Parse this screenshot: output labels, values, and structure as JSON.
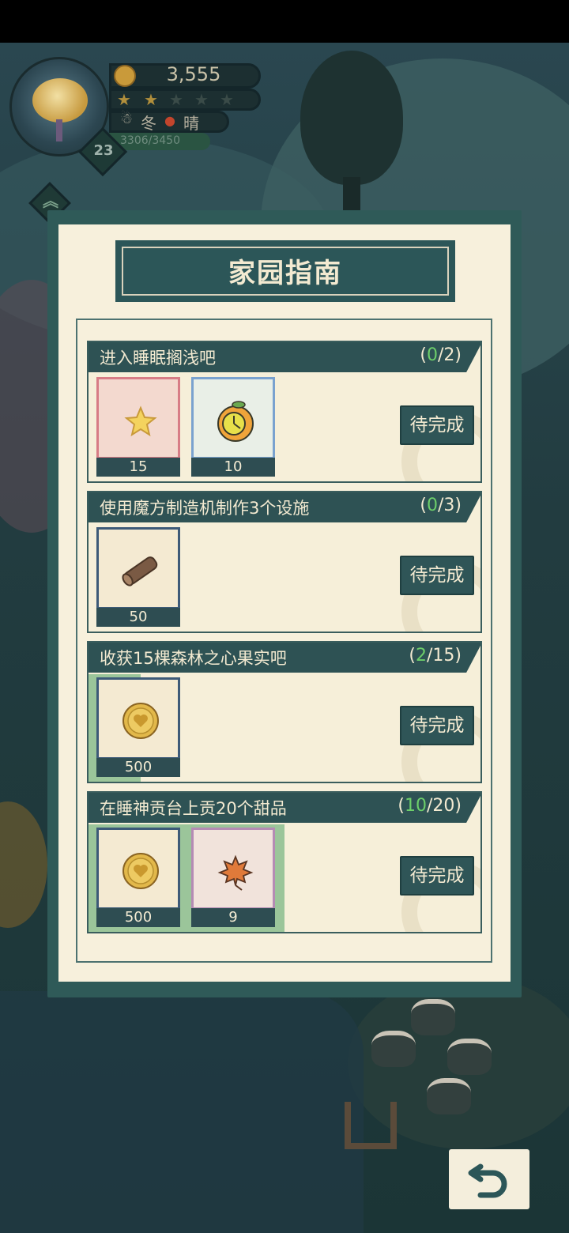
{
  "hud": {
    "coins": "3,555",
    "stars_filled": 2,
    "stars_total": 5,
    "season": "冬",
    "weather": "晴",
    "xp": "3306/3450",
    "level": "23"
  },
  "dialog": {
    "title": "家园指南",
    "tasks": [
      {
        "title": "进入睡眠搁浅吧",
        "progress_current": "0",
        "progress_total": "2",
        "progress_fraction": 0.0,
        "action_label": "待完成",
        "rewards": [
          {
            "icon": "star-icon",
            "count": "15",
            "frame_color": "#d77c86"
          },
          {
            "icon": "fruit-clock-icon",
            "count": "10",
            "frame_color": "#7aa2cf"
          }
        ]
      },
      {
        "title": "使用魔方制造机制作3个设施",
        "progress_current": "0",
        "progress_total": "3",
        "progress_fraction": 0.0,
        "action_label": "待完成",
        "rewards": [
          {
            "icon": "wood-log-icon",
            "count": "50",
            "frame_color": "#3d5a78"
          }
        ]
      },
      {
        "title": "收获15棵森林之心果实吧",
        "progress_current": "2",
        "progress_total": "15",
        "progress_fraction": 0.133,
        "action_label": "待完成",
        "rewards": [
          {
            "icon": "heart-coin-icon",
            "count": "500",
            "frame_color": "#3d5a78"
          }
        ]
      },
      {
        "title": "在睡神贡台上贡20个甜品",
        "progress_current": "10",
        "progress_total": "20",
        "progress_fraction": 0.5,
        "action_label": "待完成",
        "rewards": [
          {
            "icon": "heart-coin-icon",
            "count": "500",
            "frame_color": "#3d5a78"
          },
          {
            "icon": "maple-leaf-icon",
            "count": "9",
            "frame_color": "#b58bb4"
          }
        ]
      }
    ]
  },
  "back_button_icon": "undo-arrow-icon"
}
